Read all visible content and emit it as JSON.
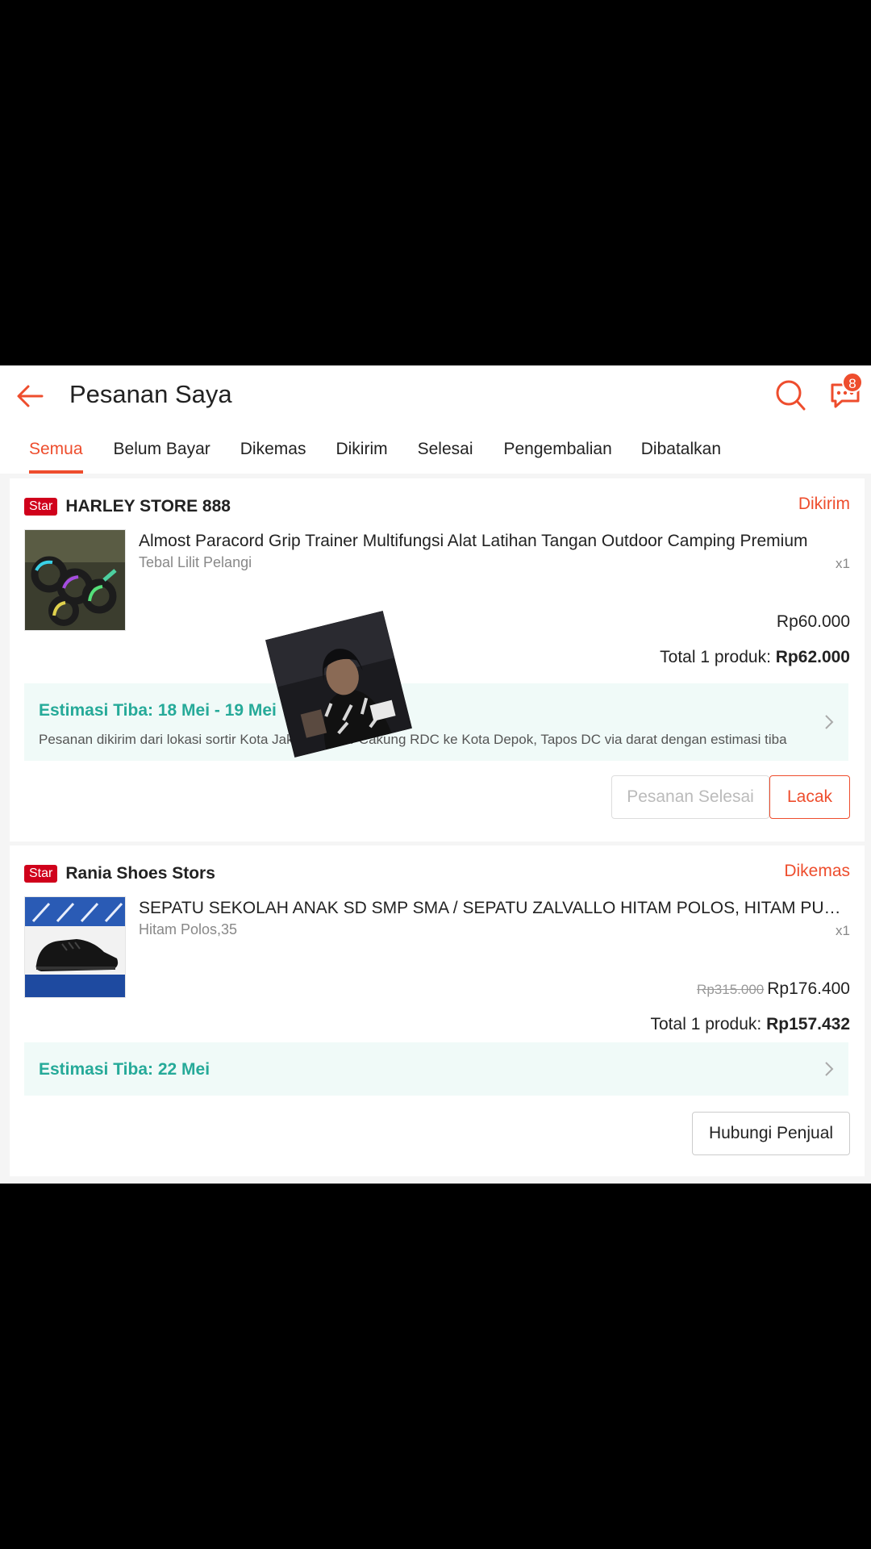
{
  "header": {
    "title": "Pesanan Saya",
    "chat_badge": "8"
  },
  "tabs": [
    {
      "label": "Semua",
      "active": true
    },
    {
      "label": "Belum Bayar"
    },
    {
      "label": "Dikemas"
    },
    {
      "label": "Dikirim"
    },
    {
      "label": "Selesai"
    },
    {
      "label": "Pengembalian"
    },
    {
      "label": "Dibatalkan"
    }
  ],
  "orders": [
    {
      "badge": "Star",
      "shop": "HARLEY STORE 888",
      "status": "Dikirim",
      "product": "Almost Paracord Grip Trainer Multifungsi Alat Latihan Tangan Outdoor Camping Premium",
      "variant": "Tebal Lilit Pelangi",
      "qty": "x1",
      "price": "Rp60.000",
      "total_label": "Total 1 produk: ",
      "total_value": "Rp62.000",
      "eta_title": "Estimasi Tiba: 18 Mei - 19 Mei",
      "eta_desc": "Pesanan dikirim dari lokasi sortir Kota Jakarta Timur  Cakung RDC ke Kota Depok, Tapos DC via darat dengan estimasi tiba",
      "btn_done": "Pesanan Selesai",
      "btn_track": "Lacak"
    },
    {
      "badge": "Star",
      "shop": "Rania Shoes Stors",
      "status": "Dikemas",
      "product": "SEPATU SEKOLAH ANAK SD SMP SMA / SEPATU ZALVALLO HITAM POLOS, HITAM PUTIH",
      "variant": "Hitam Polos,35",
      "qty": "x1",
      "price_original": "Rp315.000",
      "price": "Rp176.400",
      "total_label": "Total 1 produk: ",
      "total_value": "Rp157.432",
      "eta_title": "Estimasi Tiba: 22 Mei",
      "btn_contact": "Hubungi Penjual"
    }
  ],
  "colors": {
    "accent": "#ee4d2d",
    "eta_green": "#26aa99",
    "eta_bg": "#f0faf8"
  }
}
